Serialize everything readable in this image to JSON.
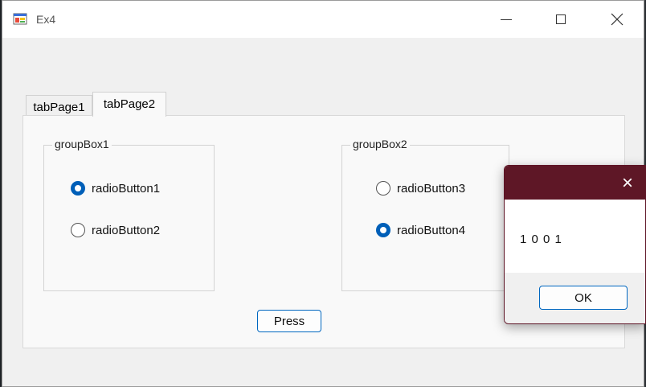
{
  "window": {
    "title": "Ex4",
    "icon": "app-form-icon",
    "controls": {
      "minimize": "minimize-icon",
      "maximize": "maximize-icon",
      "close": "close-icon"
    }
  },
  "tabs": [
    {
      "label": "tabPage1",
      "selected": false
    },
    {
      "label": "tabPage2",
      "selected": true
    }
  ],
  "groupBox1": {
    "caption": "groupBox1",
    "radios": [
      {
        "label": "radioButton1",
        "checked": true
      },
      {
        "label": "radioButton2",
        "checked": false
      }
    ]
  },
  "groupBox2": {
    "caption": "groupBox2",
    "radios": [
      {
        "label": "radioButton3",
        "checked": false
      },
      {
        "label": "radioButton4",
        "checked": true
      }
    ]
  },
  "press_button": "Press",
  "message_box": {
    "text": "1 0 0 1",
    "ok_label": "OK",
    "close_icon": "×",
    "accent": "#5e1726"
  },
  "colors": {
    "radio_checked": "#005fb8",
    "button_border": "#0067c0"
  }
}
